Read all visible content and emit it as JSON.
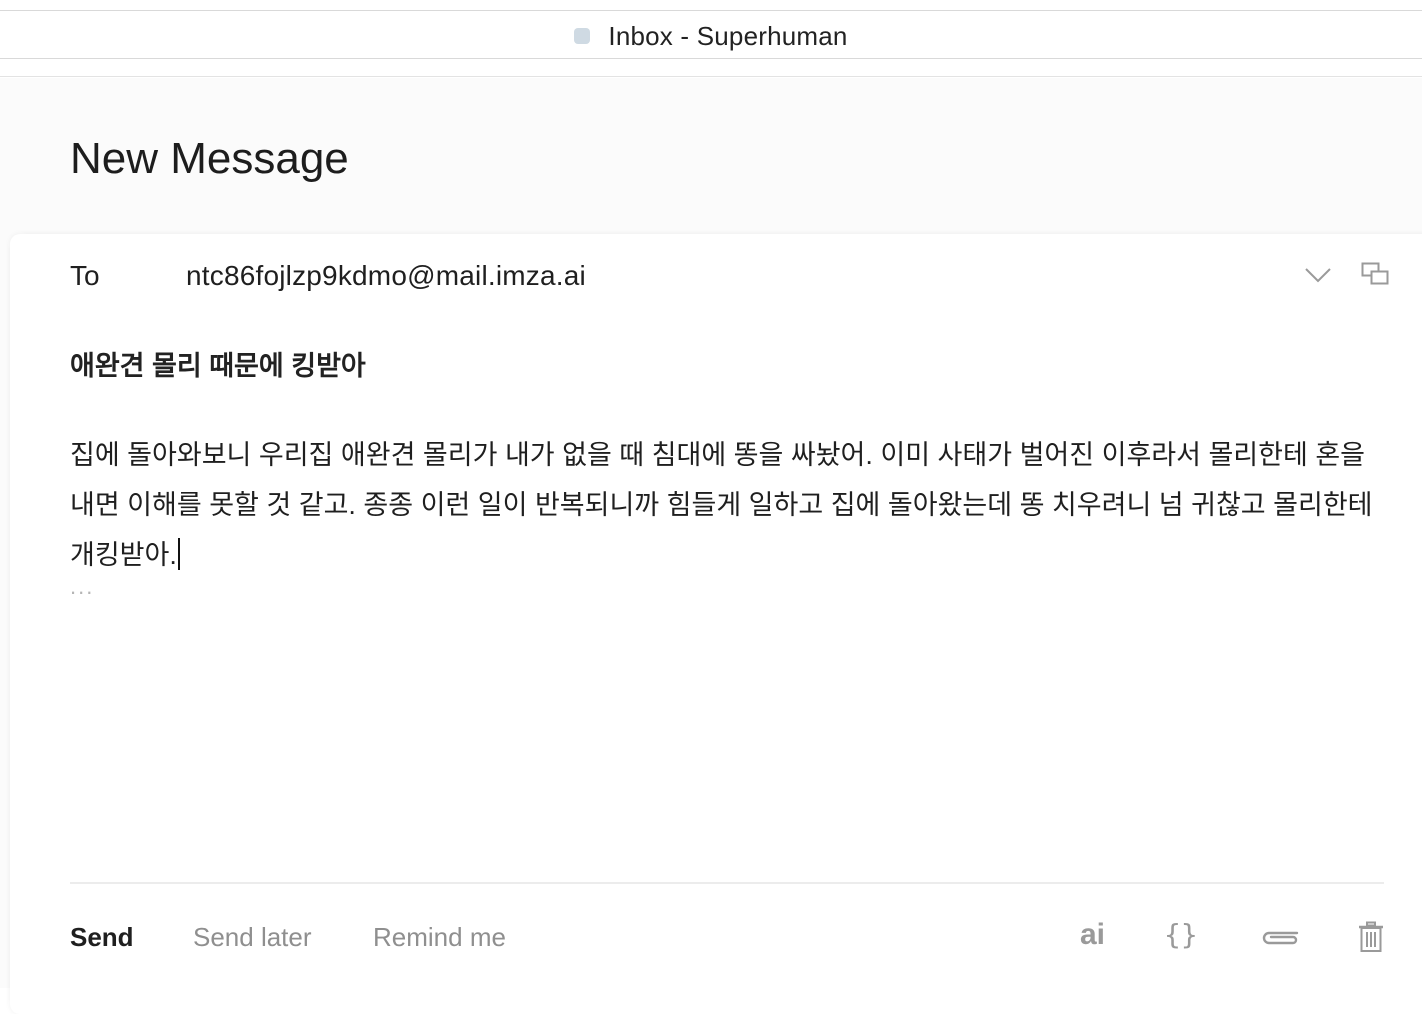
{
  "window": {
    "title": "Inbox - Superhuman"
  },
  "page": {
    "heading": "New Message"
  },
  "compose": {
    "to_label": "To",
    "to_value": "ntc86fojlzp9kdmo@mail.imza.ai",
    "subject": "애완견 몰리 때문에 킹받아",
    "body": "집에 돌아와보니 우리집 애완견 몰리가 내가 없을 때 침대에 똥을 싸놨어. 이미 사태가 벌어진 이후라서 몰리한테 혼을 내면 이해를 못할 것 같고. 종종 이런 일이 반복되니까 힘들게 일하고 집에 돌아왔는데 똥 치우려니 넘 귀찮고 몰리한테 개킹받아.",
    "ellipsis": "...",
    "header_icons": [
      "chevron-down-icon",
      "popout-window-icon"
    ]
  },
  "footer": {
    "send_label": "Send",
    "send_later_label": "Send later",
    "remind_me_label": "Remind me",
    "ai_label": "ai",
    "templates_label": "{}",
    "icons": [
      "paperclip-icon",
      "trash-icon"
    ]
  },
  "colors": {
    "favicon": "#cfdae3",
    "muted_text": "#8f8f8f",
    "icon_gray": "#9a9a9a",
    "page_bg": "#fbfbfb"
  }
}
